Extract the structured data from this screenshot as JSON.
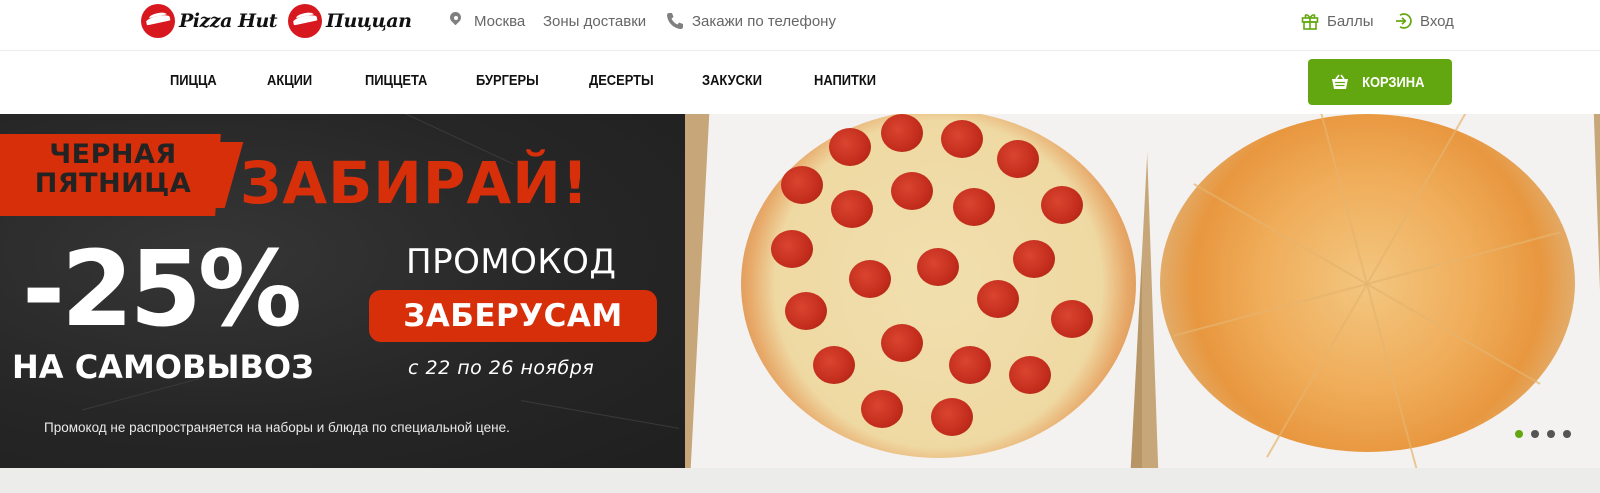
{
  "header": {
    "logo_pizzahut": "Pizza Hut",
    "logo_pizzeria": "Пиццаn",
    "city": "Москва",
    "delivery_zones": "Зоны доставки",
    "order_by_phone": "Закажи по телефону",
    "points": "Баллы",
    "login": "Вход"
  },
  "nav": {
    "items": [
      {
        "label": "ПИЦЦА"
      },
      {
        "label": "АКЦИИ"
      },
      {
        "label": "ПИЦЦЕТА"
      },
      {
        "label": "БУРГЕРЫ"
      },
      {
        "label": "ДЕСЕРТЫ"
      },
      {
        "label": "ЗАКУСКИ"
      },
      {
        "label": "НАПИТКИ"
      }
    ],
    "cart_label": "КОРЗИНА"
  },
  "banner": {
    "badge_line1": "ЧЕРНАЯ",
    "badge_line2": "ПЯТНИЦА",
    "headline": "ЗАБИРАЙ!",
    "discount": "-25%",
    "pickup": "НА САМОВЫВОЗ",
    "promo_label": "ПРОМОКОД",
    "promo_code": "ЗАБЕРУСАМ",
    "dates": "с 22 по 26 ноября",
    "disclaimer": "Промокод не распространяется на наборы и блюда по специальной цене.",
    "slides_total": 4,
    "slide_active": 1
  },
  "colors": {
    "brand_red": "#d72f0a",
    "cart_green": "#62a70f",
    "logo_red": "#d7191f"
  },
  "icons": [
    "map-pin-icon",
    "phone-icon",
    "gift-icon",
    "login-icon",
    "basket-icon"
  ]
}
